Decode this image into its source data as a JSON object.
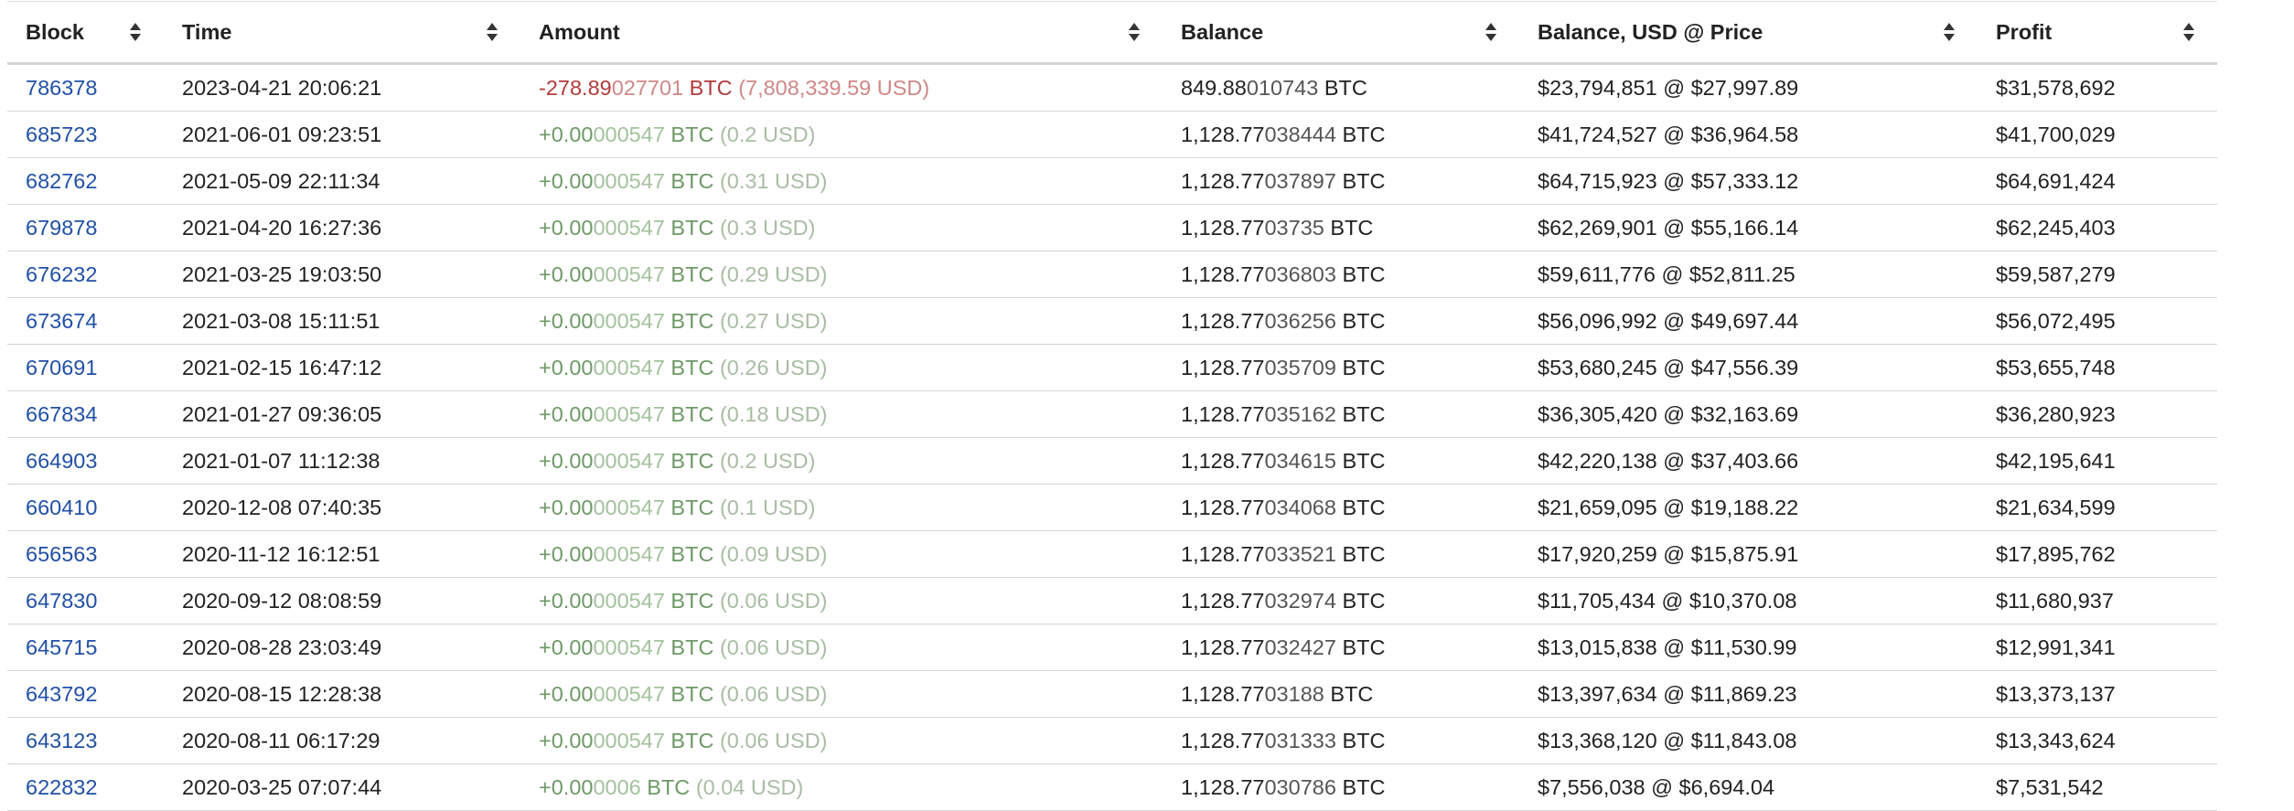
{
  "table": {
    "columns": [
      {
        "key": "block",
        "label": "Block"
      },
      {
        "key": "time",
        "label": "Time"
      },
      {
        "key": "amount",
        "label": "Amount"
      },
      {
        "key": "balance",
        "label": "Balance"
      },
      {
        "key": "balance_usd_price",
        "label": "Balance, USD @ Price"
      },
      {
        "key": "profit",
        "label": "Profit"
      }
    ],
    "sort_icon": "sort-both-icon",
    "rows": [
      {
        "block": "786378",
        "time": "2023-04-21 20:06:21",
        "amount_main": "-278.89",
        "amount_dim": "027701",
        "amount_unit": "BTC",
        "amount_usd": "(7,808,339.59 USD)",
        "direction": "out",
        "balance_main": "849.88",
        "balance_dim": "010743",
        "balance_unit": "BTC",
        "balance_usd_price": "$23,794,851 @ $27,997.89",
        "profit": "$31,578,692"
      },
      {
        "block": "685723",
        "time": "2021-06-01 09:23:51",
        "amount_main": "+0.00",
        "amount_dim": "000547",
        "amount_unit": "BTC",
        "amount_usd": "(0.2 USD)",
        "direction": "in",
        "balance_main": "1,128.77",
        "balance_dim": "038444",
        "balance_unit": "BTC",
        "balance_usd_price": "$41,724,527 @ $36,964.58",
        "profit": "$41,700,029"
      },
      {
        "block": "682762",
        "time": "2021-05-09 22:11:34",
        "amount_main": "+0.00",
        "amount_dim": "000547",
        "amount_unit": "BTC",
        "amount_usd": "(0.31 USD)",
        "direction": "in",
        "balance_main": "1,128.77",
        "balance_dim": "037897",
        "balance_unit": "BTC",
        "balance_usd_price": "$64,715,923 @ $57,333.12",
        "profit": "$64,691,424"
      },
      {
        "block": "679878",
        "time": "2021-04-20 16:27:36",
        "amount_main": "+0.00",
        "amount_dim": "000547",
        "amount_unit": "BTC",
        "amount_usd": "(0.3 USD)",
        "direction": "in",
        "balance_main": "1,128.77",
        "balance_dim": "03735",
        "balance_unit": "BTC",
        "balance_usd_price": "$62,269,901 @ $55,166.14",
        "profit": "$62,245,403"
      },
      {
        "block": "676232",
        "time": "2021-03-25 19:03:50",
        "amount_main": "+0.00",
        "amount_dim": "000547",
        "amount_unit": "BTC",
        "amount_usd": "(0.29 USD)",
        "direction": "in",
        "balance_main": "1,128.77",
        "balance_dim": "036803",
        "balance_unit": "BTC",
        "balance_usd_price": "$59,611,776 @ $52,811.25",
        "profit": "$59,587,279"
      },
      {
        "block": "673674",
        "time": "2021-03-08 15:11:51",
        "amount_main": "+0.00",
        "amount_dim": "000547",
        "amount_unit": "BTC",
        "amount_usd": "(0.27 USD)",
        "direction": "in",
        "balance_main": "1,128.77",
        "balance_dim": "036256",
        "balance_unit": "BTC",
        "balance_usd_price": "$56,096,992 @ $49,697.44",
        "profit": "$56,072,495"
      },
      {
        "block": "670691",
        "time": "2021-02-15 16:47:12",
        "amount_main": "+0.00",
        "amount_dim": "000547",
        "amount_unit": "BTC",
        "amount_usd": "(0.26 USD)",
        "direction": "in",
        "balance_main": "1,128.77",
        "balance_dim": "035709",
        "balance_unit": "BTC",
        "balance_usd_price": "$53,680,245 @ $47,556.39",
        "profit": "$53,655,748"
      },
      {
        "block": "667834",
        "time": "2021-01-27 09:36:05",
        "amount_main": "+0.00",
        "amount_dim": "000547",
        "amount_unit": "BTC",
        "amount_usd": "(0.18 USD)",
        "direction": "in",
        "balance_main": "1,128.77",
        "balance_dim": "035162",
        "balance_unit": "BTC",
        "balance_usd_price": "$36,305,420 @ $32,163.69",
        "profit": "$36,280,923"
      },
      {
        "block": "664903",
        "time": "2021-01-07 11:12:38",
        "amount_main": "+0.00",
        "amount_dim": "000547",
        "amount_unit": "BTC",
        "amount_usd": "(0.2 USD)",
        "direction": "in",
        "balance_main": "1,128.77",
        "balance_dim": "034615",
        "balance_unit": "BTC",
        "balance_usd_price": "$42,220,138 @ $37,403.66",
        "profit": "$42,195,641"
      },
      {
        "block": "660410",
        "time": "2020-12-08 07:40:35",
        "amount_main": "+0.00",
        "amount_dim": "000547",
        "amount_unit": "BTC",
        "amount_usd": "(0.1 USD)",
        "direction": "in",
        "balance_main": "1,128.77",
        "balance_dim": "034068",
        "balance_unit": "BTC",
        "balance_usd_price": "$21,659,095 @ $19,188.22",
        "profit": "$21,634,599"
      },
      {
        "block": "656563",
        "time": "2020-11-12 16:12:51",
        "amount_main": "+0.00",
        "amount_dim": "000547",
        "amount_unit": "BTC",
        "amount_usd": "(0.09 USD)",
        "direction": "in",
        "balance_main": "1,128.77",
        "balance_dim": "033521",
        "balance_unit": "BTC",
        "balance_usd_price": "$17,920,259 @ $15,875.91",
        "profit": "$17,895,762"
      },
      {
        "block": "647830",
        "time": "2020-09-12 08:08:59",
        "amount_main": "+0.00",
        "amount_dim": "000547",
        "amount_unit": "BTC",
        "amount_usd": "(0.06 USD)",
        "direction": "in",
        "balance_main": "1,128.77",
        "balance_dim": "032974",
        "balance_unit": "BTC",
        "balance_usd_price": "$11,705,434 @ $10,370.08",
        "profit": "$11,680,937"
      },
      {
        "block": "645715",
        "time": "2020-08-28 23:03:49",
        "amount_main": "+0.00",
        "amount_dim": "000547",
        "amount_unit": "BTC",
        "amount_usd": "(0.06 USD)",
        "direction": "in",
        "balance_main": "1,128.77",
        "balance_dim": "032427",
        "balance_unit": "BTC",
        "balance_usd_price": "$13,015,838 @ $11,530.99",
        "profit": "$12,991,341"
      },
      {
        "block": "643792",
        "time": "2020-08-15 12:28:38",
        "amount_main": "+0.00",
        "amount_dim": "000547",
        "amount_unit": "BTC",
        "amount_usd": "(0.06 USD)",
        "direction": "in",
        "balance_main": "1,128.77",
        "balance_dim": "03188",
        "balance_unit": "BTC",
        "balance_usd_price": "$13,397,634 @ $11,869.23",
        "profit": "$13,373,137"
      },
      {
        "block": "643123",
        "time": "2020-08-11 06:17:29",
        "amount_main": "+0.00",
        "amount_dim": "000547",
        "amount_unit": "BTC",
        "amount_usd": "(0.06 USD)",
        "direction": "in",
        "balance_main": "1,128.77",
        "balance_dim": "031333",
        "balance_unit": "BTC",
        "balance_usd_price": "$13,368,120 @ $11,843.08",
        "profit": "$13,343,624"
      },
      {
        "block": "622832",
        "time": "2020-03-25 07:07:44",
        "amount_main": "+0.00",
        "amount_dim": "0006",
        "amount_unit": "BTC",
        "amount_usd": "(0.04 USD)",
        "direction": "in",
        "balance_main": "1,128.77",
        "balance_dim": "030786",
        "balance_unit": "BTC",
        "balance_usd_price": "$7,556,038 @ $6,694.04",
        "profit": "$7,531,542"
      }
    ]
  }
}
